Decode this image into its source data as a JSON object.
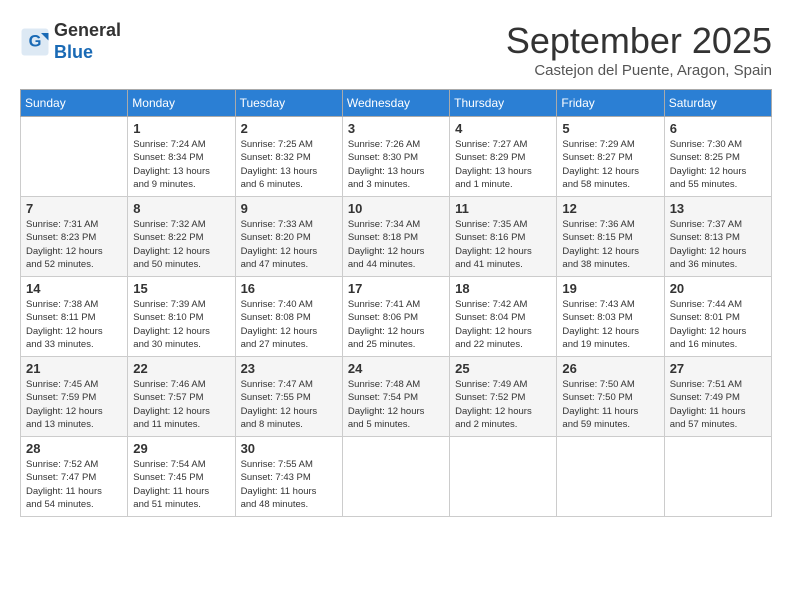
{
  "header": {
    "logo_line1": "General",
    "logo_line2": "Blue",
    "month_title": "September 2025",
    "subtitle": "Castejon del Puente, Aragon, Spain"
  },
  "columns": [
    "Sunday",
    "Monday",
    "Tuesday",
    "Wednesday",
    "Thursday",
    "Friday",
    "Saturday"
  ],
  "weeks": [
    [
      {
        "day": "",
        "info": ""
      },
      {
        "day": "1",
        "info": "Sunrise: 7:24 AM\nSunset: 8:34 PM\nDaylight: 13 hours\nand 9 minutes."
      },
      {
        "day": "2",
        "info": "Sunrise: 7:25 AM\nSunset: 8:32 PM\nDaylight: 13 hours\nand 6 minutes."
      },
      {
        "day": "3",
        "info": "Sunrise: 7:26 AM\nSunset: 8:30 PM\nDaylight: 13 hours\nand 3 minutes."
      },
      {
        "day": "4",
        "info": "Sunrise: 7:27 AM\nSunset: 8:29 PM\nDaylight: 13 hours\nand 1 minute."
      },
      {
        "day": "5",
        "info": "Sunrise: 7:29 AM\nSunset: 8:27 PM\nDaylight: 12 hours\nand 58 minutes."
      },
      {
        "day": "6",
        "info": "Sunrise: 7:30 AM\nSunset: 8:25 PM\nDaylight: 12 hours\nand 55 minutes."
      }
    ],
    [
      {
        "day": "7",
        "info": "Sunrise: 7:31 AM\nSunset: 8:23 PM\nDaylight: 12 hours\nand 52 minutes."
      },
      {
        "day": "8",
        "info": "Sunrise: 7:32 AM\nSunset: 8:22 PM\nDaylight: 12 hours\nand 50 minutes."
      },
      {
        "day": "9",
        "info": "Sunrise: 7:33 AM\nSunset: 8:20 PM\nDaylight: 12 hours\nand 47 minutes."
      },
      {
        "day": "10",
        "info": "Sunrise: 7:34 AM\nSunset: 8:18 PM\nDaylight: 12 hours\nand 44 minutes."
      },
      {
        "day": "11",
        "info": "Sunrise: 7:35 AM\nSunset: 8:16 PM\nDaylight: 12 hours\nand 41 minutes."
      },
      {
        "day": "12",
        "info": "Sunrise: 7:36 AM\nSunset: 8:15 PM\nDaylight: 12 hours\nand 38 minutes."
      },
      {
        "day": "13",
        "info": "Sunrise: 7:37 AM\nSunset: 8:13 PM\nDaylight: 12 hours\nand 36 minutes."
      }
    ],
    [
      {
        "day": "14",
        "info": "Sunrise: 7:38 AM\nSunset: 8:11 PM\nDaylight: 12 hours\nand 33 minutes."
      },
      {
        "day": "15",
        "info": "Sunrise: 7:39 AM\nSunset: 8:10 PM\nDaylight: 12 hours\nand 30 minutes."
      },
      {
        "day": "16",
        "info": "Sunrise: 7:40 AM\nSunset: 8:08 PM\nDaylight: 12 hours\nand 27 minutes."
      },
      {
        "day": "17",
        "info": "Sunrise: 7:41 AM\nSunset: 8:06 PM\nDaylight: 12 hours\nand 25 minutes."
      },
      {
        "day": "18",
        "info": "Sunrise: 7:42 AM\nSunset: 8:04 PM\nDaylight: 12 hours\nand 22 minutes."
      },
      {
        "day": "19",
        "info": "Sunrise: 7:43 AM\nSunset: 8:03 PM\nDaylight: 12 hours\nand 19 minutes."
      },
      {
        "day": "20",
        "info": "Sunrise: 7:44 AM\nSunset: 8:01 PM\nDaylight: 12 hours\nand 16 minutes."
      }
    ],
    [
      {
        "day": "21",
        "info": "Sunrise: 7:45 AM\nSunset: 7:59 PM\nDaylight: 12 hours\nand 13 minutes."
      },
      {
        "day": "22",
        "info": "Sunrise: 7:46 AM\nSunset: 7:57 PM\nDaylight: 12 hours\nand 11 minutes."
      },
      {
        "day": "23",
        "info": "Sunrise: 7:47 AM\nSunset: 7:55 PM\nDaylight: 12 hours\nand 8 minutes."
      },
      {
        "day": "24",
        "info": "Sunrise: 7:48 AM\nSunset: 7:54 PM\nDaylight: 12 hours\nand 5 minutes."
      },
      {
        "day": "25",
        "info": "Sunrise: 7:49 AM\nSunset: 7:52 PM\nDaylight: 12 hours\nand 2 minutes."
      },
      {
        "day": "26",
        "info": "Sunrise: 7:50 AM\nSunset: 7:50 PM\nDaylight: 11 hours\nand 59 minutes."
      },
      {
        "day": "27",
        "info": "Sunrise: 7:51 AM\nSunset: 7:49 PM\nDaylight: 11 hours\nand 57 minutes."
      }
    ],
    [
      {
        "day": "28",
        "info": "Sunrise: 7:52 AM\nSunset: 7:47 PM\nDaylight: 11 hours\nand 54 minutes."
      },
      {
        "day": "29",
        "info": "Sunrise: 7:54 AM\nSunset: 7:45 PM\nDaylight: 11 hours\nand 51 minutes."
      },
      {
        "day": "30",
        "info": "Sunrise: 7:55 AM\nSunset: 7:43 PM\nDaylight: 11 hours\nand 48 minutes."
      },
      {
        "day": "",
        "info": ""
      },
      {
        "day": "",
        "info": ""
      },
      {
        "day": "",
        "info": ""
      },
      {
        "day": "",
        "info": ""
      }
    ]
  ]
}
